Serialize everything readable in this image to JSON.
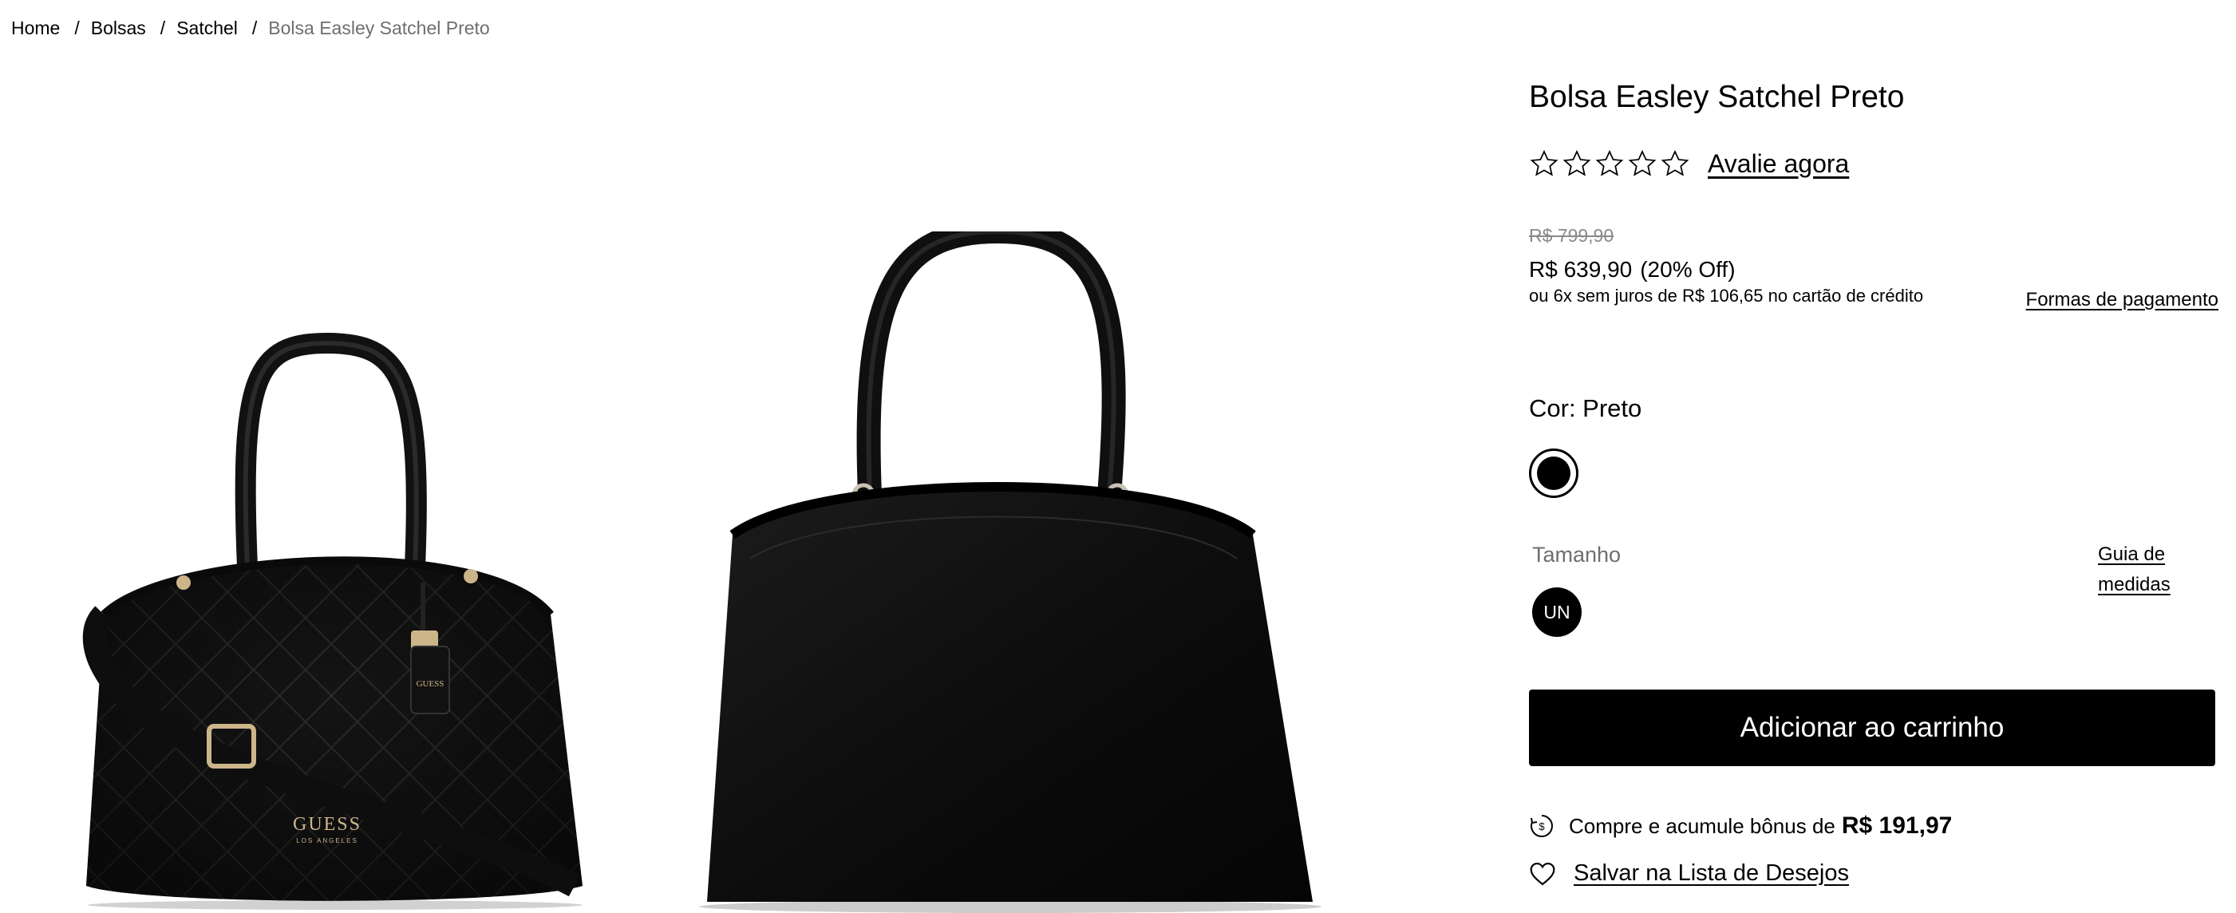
{
  "breadcrumb": {
    "items": [
      "Home",
      "Bolsas",
      "Satchel"
    ],
    "separator": "/",
    "current": "Bolsa Easley Satchel Preto"
  },
  "gallery": {
    "images": [
      {
        "alt": "quilted-satchel-with-strap",
        "brand_lettering": "GUESS",
        "brand_sub": "LOS ANGELES"
      },
      {
        "alt": "smooth-satchel-front"
      }
    ]
  },
  "product": {
    "title": "Bolsa Easley Satchel Preto",
    "rating": {
      "stars": 0,
      "max": 5,
      "link_label": "Avalie agora"
    },
    "old_price": "R$ 799,90",
    "price": "R$ 639,90",
    "discount": "(20% Off)",
    "installments": "ou 6x sem juros de R$ 106,65 no cartão de crédito",
    "payment_link": "Formas de pagamento",
    "color": {
      "label": "Cor: Preto",
      "selected_hex": "#000000"
    },
    "size": {
      "label": "Tamanho",
      "guide_line1": "Guia de",
      "guide_line2": "medidas",
      "option": "UN"
    },
    "add_to_cart": "Adicionar ao carrinho",
    "bonus": {
      "text": "Compre e acumule bônus de",
      "amount": "R$ 191,97",
      "icon_symbol": "$"
    },
    "wishlist": "Salvar na Lista de Desejos"
  },
  "colors": {
    "accent": "#000000",
    "muted_text": "#6e6e6e",
    "strike_price": "#8a8a8a"
  },
  "icons": [
    "star-outline-icon",
    "bonus-coin-icon",
    "heart-outline-icon"
  ]
}
